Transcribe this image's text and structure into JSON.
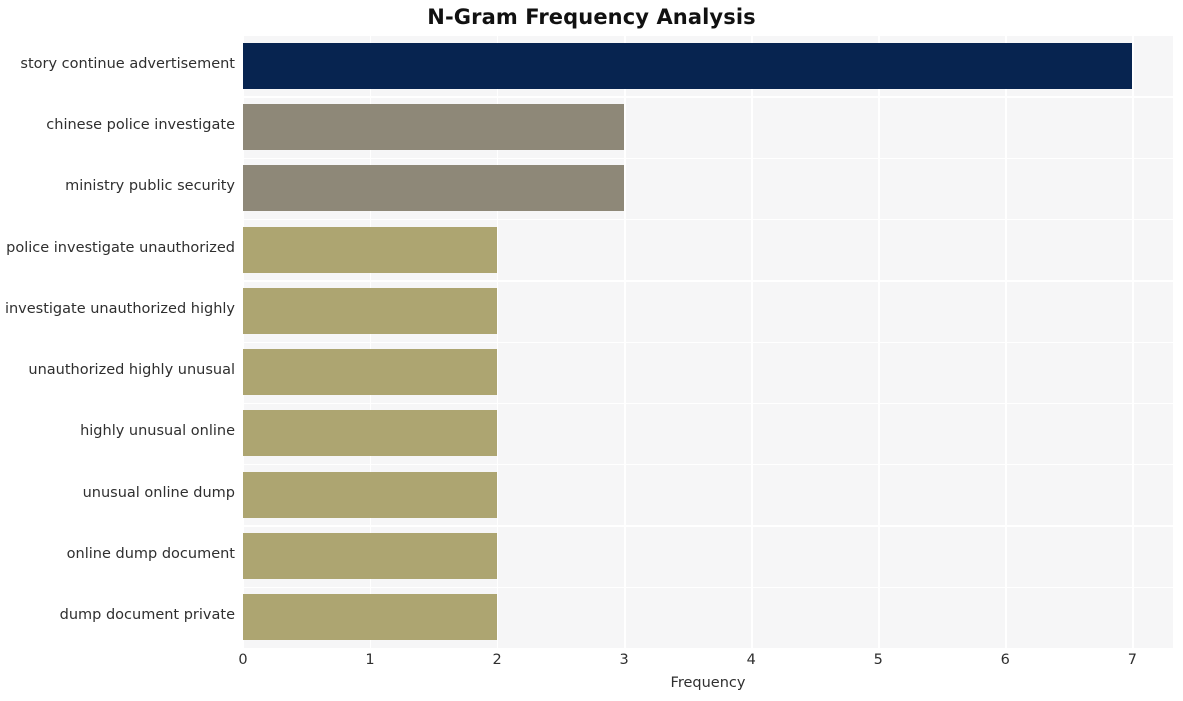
{
  "chart_data": {
    "type": "bar",
    "orientation": "horizontal",
    "title": "N-Gram Frequency Analysis",
    "xlabel": "Frequency",
    "ylabel": "",
    "categories": [
      "story continue advertisement",
      "chinese police investigate",
      "ministry public security",
      "police investigate unauthorized",
      "investigate unauthorized highly",
      "unauthorized highly unusual",
      "highly unusual online",
      "unusual online dump",
      "online dump document",
      "dump document private"
    ],
    "values": [
      7,
      3,
      3,
      2,
      2,
      2,
      2,
      2,
      2,
      2
    ],
    "bar_colors": [
      "#072450",
      "#8e8878",
      "#8e8878",
      "#ada571",
      "#ada571",
      "#ada571",
      "#ada571",
      "#ada571",
      "#ada571",
      "#ada571"
    ],
    "xticks": [
      "0",
      "1",
      "2",
      "3",
      "4",
      "5",
      "6",
      "7"
    ],
    "xtick_values": [
      0,
      1,
      2,
      3,
      4,
      5,
      6,
      7
    ],
    "xlim": [
      0,
      7.32
    ],
    "grid": true,
    "grid_color": "#ffffff",
    "plot_background": "#f6f6f7",
    "figure_background": "#ffffff",
    "legend": null,
    "legend_position": "none",
    "title_color": "#111111",
    "tick_color": "#2f2f2f"
  }
}
